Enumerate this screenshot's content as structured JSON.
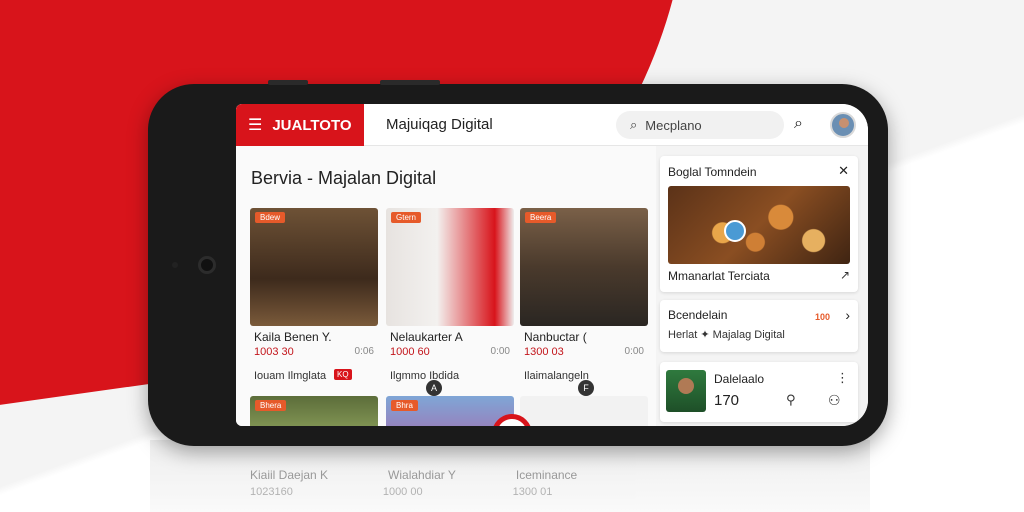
{
  "header": {
    "logo": "JUALTOTO",
    "site_title": "Majuiqag Digital",
    "search_placeholder": "Mecplano"
  },
  "main": {
    "section_title": "Bervia - Majalan Digital",
    "cards": [
      {
        "tag": "Bdew",
        "title": "Kaila Benen Y.",
        "views": "1003 30",
        "meta": "0:06",
        "source": "Iouam Ilmglata",
        "badges": [
          "KQ"
        ]
      },
      {
        "tag": "Gtern",
        "title": "Nelaukarter A",
        "views": "1000 60",
        "meta": "0:00",
        "source": "Ilgmmo Ibdida",
        "badges": [
          "A"
        ]
      },
      {
        "tag": "Beera",
        "title": "Nanbuctar (",
        "views": "1300 03",
        "meta": "0:00",
        "source": "Ilaimalangeln",
        "badges": [
          "F"
        ]
      }
    ],
    "row2_tags": [
      "Bhera",
      "Bhra"
    ]
  },
  "sidebar": {
    "panel1": {
      "title": "Boglal Tomndein",
      "caption": "Mmanarlat Terciata"
    },
    "panel2": {
      "title": "Bcendelain",
      "subtitle": "Herlat ✦ Majalag Digital",
      "badge": "100"
    },
    "panel3": {
      "name": "Dalelaalo",
      "count": "170"
    }
  },
  "reflection": {
    "titles": [
      "Kiaiil Daejan K",
      "Wialahdiar Y",
      "Iceminance"
    ],
    "subs": [
      "1023160",
      "1000 00",
      "1300 01"
    ]
  },
  "colors": {
    "brand": "#d8141b",
    "accent": "#e65a2a"
  }
}
